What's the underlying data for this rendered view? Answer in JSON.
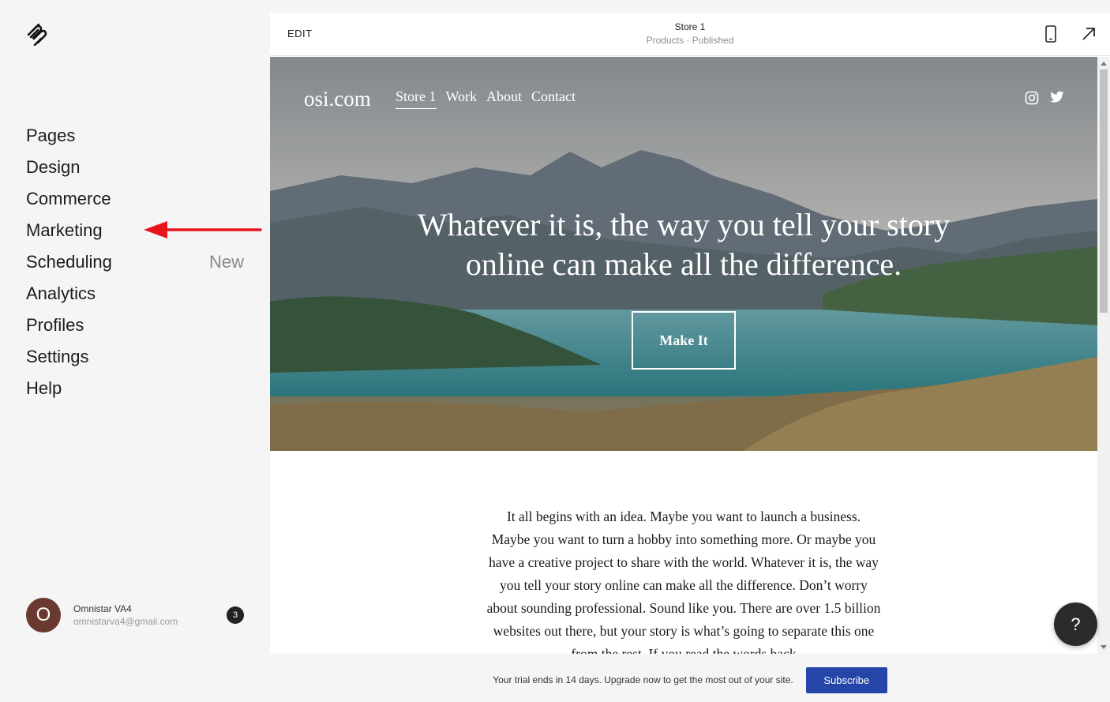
{
  "sidebar": {
    "nav": [
      {
        "label": "Pages",
        "badge": ""
      },
      {
        "label": "Design",
        "badge": ""
      },
      {
        "label": "Commerce",
        "badge": ""
      },
      {
        "label": "Marketing",
        "badge": ""
      },
      {
        "label": "Scheduling",
        "badge": "New"
      },
      {
        "label": "Analytics",
        "badge": ""
      },
      {
        "label": "Profiles",
        "badge": ""
      },
      {
        "label": "Settings",
        "badge": ""
      },
      {
        "label": "Help",
        "badge": ""
      }
    ],
    "annotation_arrow_color": "#e8141c",
    "profile": {
      "initial": "O",
      "name": "Omnistar VA4",
      "email": "omnistarva4@gmail.com",
      "notifications": "3",
      "avatar_color": "#6a3a30"
    }
  },
  "preview": {
    "edit_label": "EDIT",
    "page_name": "Store 1",
    "page_status": "Products · Published",
    "icons": [
      "mobile-icon",
      "expand-icon"
    ]
  },
  "site": {
    "logo": "osi.com",
    "nav": [
      "Store 1",
      "Work",
      "About",
      "Contact"
    ],
    "active_nav": "Store 1",
    "social_icons": [
      "instagram-icon",
      "twitter-icon"
    ],
    "hero_title": "Whatever it is, the way you tell your story online can make all the difference.",
    "hero_button": "Make It",
    "body_text": "It all begins with an idea. Maybe you want to launch a business. Maybe you want to turn a hobby into something more. Or maybe you have a creative project to share with the world. Whatever it is, the way you tell your story online can make all the difference. Don’t worry about sounding professional. Sound like you. There are over 1.5 billion websites out there, but your story is what’s going to separate this one from the rest. If you read the words back"
  },
  "help_fab": "?",
  "trial": {
    "text": "Your trial ends in 14 days. Upgrade now to get the most out of your site.",
    "button": "Subscribe",
    "button_color": "#2546a8"
  }
}
